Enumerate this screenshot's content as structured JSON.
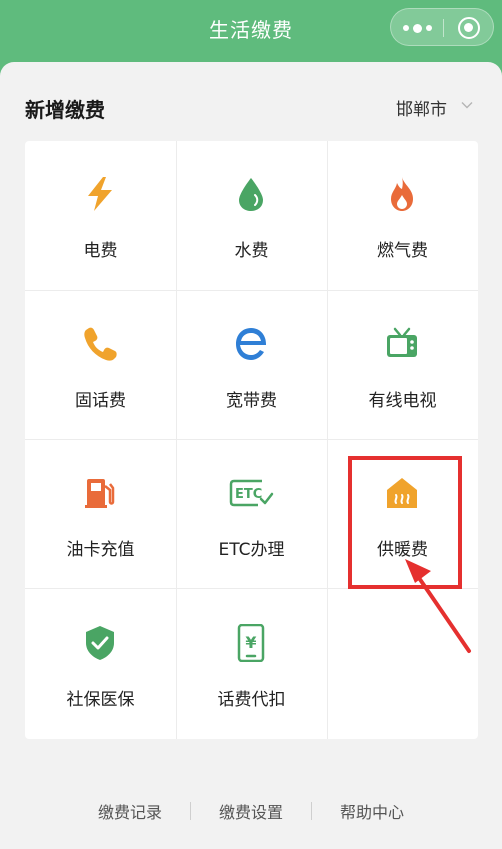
{
  "header": {
    "title": "生活缴费"
  },
  "section": {
    "title": "新增缴费",
    "city": "邯郸市"
  },
  "items": [
    {
      "label": "电费",
      "icon": "lightning-icon",
      "color": "#f0a32c"
    },
    {
      "label": "水费",
      "icon": "water-drop-icon",
      "color": "#4aa564"
    },
    {
      "label": "燃气费",
      "icon": "flame-icon",
      "color": "#e96b3a"
    },
    {
      "label": "固话费",
      "icon": "phone-icon",
      "color": "#f0a32c"
    },
    {
      "label": "宽带费",
      "icon": "broadband-e-icon",
      "color": "#2f7fd6"
    },
    {
      "label": "有线电视",
      "icon": "tv-icon",
      "color": "#4aa564"
    },
    {
      "label": "油卡充值",
      "icon": "fuel-pump-icon",
      "color": "#e96b3a"
    },
    {
      "label": "ETC办理",
      "icon": "etc-icon",
      "color": "#4aa564"
    },
    {
      "label": "供暖费",
      "icon": "heating-house-icon",
      "color": "#f0a32c"
    },
    {
      "label": "社保医保",
      "icon": "shield-check-icon",
      "color": "#4aa564"
    },
    {
      "label": "话费代扣",
      "icon": "mobile-yen-icon",
      "color": "#4aa564"
    }
  ],
  "icon_glyphs": {
    "etc": "ETC",
    "yen": "¥"
  },
  "footer": {
    "links": [
      "缴费记录",
      "缴费设置",
      "帮助中心"
    ]
  },
  "colors": {
    "brand_green": "#5fbb7d",
    "highlight_red": "#e5302f"
  }
}
